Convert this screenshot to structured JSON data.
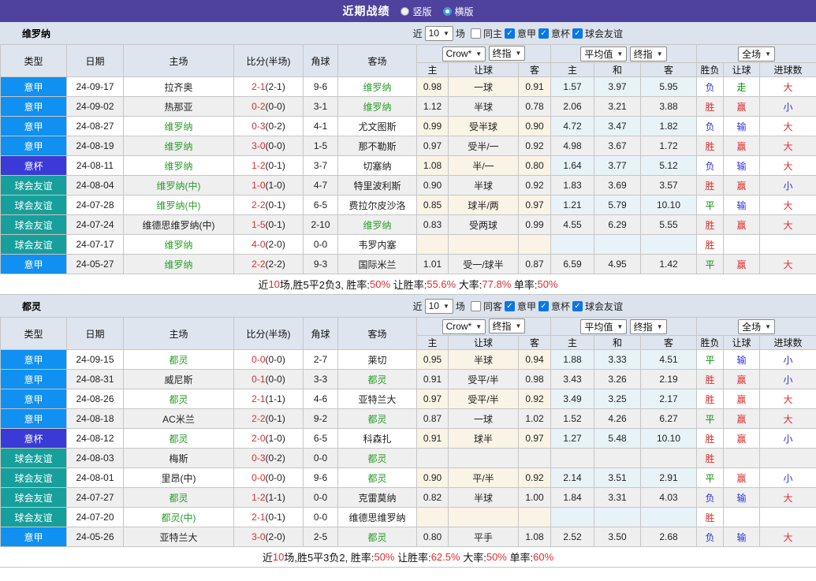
{
  "palette": {
    "topbar_bg": "#4f429e",
    "serie_a": "#1090f0",
    "coppa": "#3a3ad6",
    "friendly": "#17a09b",
    "red": "#e22c2c",
    "blue": "#3030dd",
    "green": "#0a8f0a",
    "team_green": "#2a9d2a",
    "half_score": "#222222",
    "radio_selected": "#3a9ae0",
    "checkbox_checked": "#0b76e8"
  },
  "top": {
    "title": "近期战绩",
    "modes": [
      {
        "label": "竖版",
        "selected": false
      },
      {
        "label": "横版",
        "selected": true
      }
    ]
  },
  "table_headers": {
    "main": [
      "类型",
      "日期",
      "主场",
      "比分(半场)",
      "角球",
      "客场"
    ],
    "odds_selects": [
      "Crow*",
      "终指"
    ],
    "avg_selects": [
      "平均值",
      "终指"
    ],
    "result_select": "全场",
    "odds_sub": [
      "主",
      "让球",
      "客"
    ],
    "avg_sub": [
      "主",
      "和",
      "客"
    ],
    "result_sub": [
      "胜负",
      "让球",
      "进球数"
    ]
  },
  "sections": [
    {
      "team": "维罗纳",
      "filter": {
        "near": "近",
        "count": "10",
        "games": "场",
        "same": {
          "label": "同主",
          "checked": false
        },
        "leagues": [
          {
            "label": "意甲",
            "checked": true
          },
          {
            "label": "意杯",
            "checked": true
          },
          {
            "label": "球会友谊",
            "checked": true
          }
        ]
      },
      "rows": [
        {
          "type": "意甲",
          "type_key": "serie_a",
          "date": "24-09-17",
          "home": "拉齐奥",
          "home_green": false,
          "score": "2-1",
          "half": "(2-1)",
          "corners": "9-6",
          "away": "维罗纳",
          "away_green": true,
          "odds": [
            "0.98",
            "一球",
            "0.91"
          ],
          "avg": [
            "1.57",
            "3.97",
            "5.95"
          ],
          "results": [
            [
              "负",
              "blue"
            ],
            [
              "走",
              "green"
            ],
            [
              "大",
              "red"
            ]
          ]
        },
        {
          "type": "意甲",
          "type_key": "serie_a",
          "date": "24-09-02",
          "home": "热那亚",
          "home_green": false,
          "score": "0-2",
          "half": "(0-0)",
          "corners": "3-1",
          "away": "维罗纳",
          "away_green": true,
          "odds": [
            "1.12",
            "半球",
            "0.78"
          ],
          "avg": [
            "2.06",
            "3.21",
            "3.88"
          ],
          "results": [
            [
              "胜",
              "red"
            ],
            [
              "赢",
              "red"
            ],
            [
              "小",
              "blue"
            ]
          ]
        },
        {
          "type": "意甲",
          "type_key": "serie_a",
          "date": "24-08-27",
          "home": "维罗纳",
          "home_green": true,
          "score": "0-3",
          "half": "(0-2)",
          "corners": "4-1",
          "away": "尤文图斯",
          "away_green": false,
          "odds": [
            "0.99",
            "受半球",
            "0.90"
          ],
          "avg": [
            "4.72",
            "3.47",
            "1.82"
          ],
          "results": [
            [
              "负",
              "blue"
            ],
            [
              "输",
              "blue"
            ],
            [
              "大",
              "red"
            ]
          ]
        },
        {
          "type": "意甲",
          "type_key": "serie_a",
          "date": "24-08-19",
          "home": "维罗纳",
          "home_green": true,
          "score": "3-0",
          "half": "(0-0)",
          "corners": "1-5",
          "away": "那不勒斯",
          "away_green": false,
          "odds": [
            "0.97",
            "受半/一",
            "0.92"
          ],
          "avg": [
            "4.98",
            "3.67",
            "1.72"
          ],
          "results": [
            [
              "胜",
              "red"
            ],
            [
              "赢",
              "red"
            ],
            [
              "大",
              "red"
            ]
          ]
        },
        {
          "type": "意杯",
          "type_key": "coppa",
          "date": "24-08-11",
          "home": "维罗纳",
          "home_green": true,
          "score": "1-2",
          "half": "(0-1)",
          "corners": "3-7",
          "away": "切塞纳",
          "away_green": false,
          "odds": [
            "1.08",
            "半/一",
            "0.80"
          ],
          "avg": [
            "1.64",
            "3.77",
            "5.12"
          ],
          "results": [
            [
              "负",
              "blue"
            ],
            [
              "输",
              "blue"
            ],
            [
              "大",
              "red"
            ]
          ]
        },
        {
          "type": "球会友谊",
          "type_key": "friendly",
          "date": "24-08-04",
          "home": "维罗纳(中)",
          "home_green": true,
          "score": "1-0",
          "half": "(1-0)",
          "corners": "4-7",
          "away": "特里波利斯",
          "away_green": false,
          "odds": [
            "0.90",
            "半球",
            "0.92"
          ],
          "avg": [
            "1.83",
            "3.69",
            "3.57"
          ],
          "results": [
            [
              "胜",
              "red"
            ],
            [
              "赢",
              "red"
            ],
            [
              "小",
              "blue"
            ]
          ]
        },
        {
          "type": "球会友谊",
          "type_key": "friendly",
          "date": "24-07-28",
          "home": "维罗纳(中)",
          "home_green": true,
          "score": "2-2",
          "half": "(0-1)",
          "corners": "6-5",
          "away": "费拉尔皮沙洛",
          "away_green": false,
          "odds": [
            "0.85",
            "球半/两",
            "0.97"
          ],
          "avg": [
            "1.21",
            "5.79",
            "10.10"
          ],
          "results": [
            [
              "平",
              "green"
            ],
            [
              "输",
              "blue"
            ],
            [
              "大",
              "red"
            ]
          ]
        },
        {
          "type": "球会友谊",
          "type_key": "friendly",
          "date": "24-07-24",
          "home": "维德思维罗纳(中)",
          "home_green": false,
          "score": "1-5",
          "half": "(0-1)",
          "corners": "2-10",
          "away": "维罗纳",
          "away_green": true,
          "odds": [
            "0.83",
            "受两球",
            "0.99"
          ],
          "avg": [
            "4.55",
            "6.29",
            "5.55"
          ],
          "results": [
            [
              "胜",
              "red"
            ],
            [
              "赢",
              "red"
            ],
            [
              "大",
              "red"
            ]
          ]
        },
        {
          "type": "球会友谊",
          "type_key": "friendly",
          "date": "24-07-17",
          "home": "维罗纳",
          "home_green": true,
          "score": "4-0",
          "half": "(2-0)",
          "corners": "0-0",
          "away": "韦罗内塞",
          "away_green": false,
          "odds": [
            "",
            "",
            ""
          ],
          "avg": [
            "",
            "",
            ""
          ],
          "results": [
            [
              "胜",
              "red"
            ],
            [
              "",
              ""
            ],
            [
              "",
              ""
            ]
          ]
        },
        {
          "type": "意甲",
          "type_key": "serie_a",
          "date": "24-05-27",
          "home": "维罗纳",
          "home_green": true,
          "score": "2-2",
          "half": "(2-2)",
          "corners": "9-3",
          "away": "国际米兰",
          "away_green": false,
          "odds": [
            "1.01",
            "受一/球半",
            "0.87"
          ],
          "avg": [
            "6.59",
            "4.95",
            "1.42"
          ],
          "results": [
            [
              "平",
              "green"
            ],
            [
              "赢",
              "red"
            ],
            [
              "大",
              "red"
            ]
          ]
        }
      ],
      "summary": [
        [
          "近",
          false
        ],
        [
          "10",
          true
        ],
        [
          "场,胜5平2负3, 胜率:",
          false
        ],
        [
          "50%",
          true
        ],
        [
          " 让胜率:",
          false
        ],
        [
          "55.6%",
          true
        ],
        [
          " 大率:",
          false
        ],
        [
          "77.8%",
          true
        ],
        [
          " 单率:",
          false
        ],
        [
          "50%",
          true
        ]
      ]
    },
    {
      "team": "都灵",
      "filter": {
        "near": "近",
        "count": "10",
        "games": "场",
        "same": {
          "label": "同客",
          "checked": false
        },
        "leagues": [
          {
            "label": "意甲",
            "checked": true
          },
          {
            "label": "意杯",
            "checked": true
          },
          {
            "label": "球会友谊",
            "checked": true
          }
        ]
      },
      "rows": [
        {
          "type": "意甲",
          "type_key": "serie_a",
          "date": "24-09-15",
          "home": "都灵",
          "home_green": true,
          "score": "0-0",
          "half": "(0-0)",
          "corners": "2-7",
          "away": "莱切",
          "away_green": false,
          "odds": [
            "0.95",
            "半球",
            "0.94"
          ],
          "avg": [
            "1.88",
            "3.33",
            "4.51"
          ],
          "results": [
            [
              "平",
              "green"
            ],
            [
              "输",
              "blue"
            ],
            [
              "小",
              "blue"
            ]
          ]
        },
        {
          "type": "意甲",
          "type_key": "serie_a",
          "date": "24-08-31",
          "home": "威尼斯",
          "home_green": false,
          "score": "0-1",
          "half": "(0-0)",
          "corners": "3-3",
          "away": "都灵",
          "away_green": true,
          "odds": [
            "0.91",
            "受平/半",
            "0.98"
          ],
          "avg": [
            "3.43",
            "3.26",
            "2.19"
          ],
          "results": [
            [
              "胜",
              "red"
            ],
            [
              "赢",
              "red"
            ],
            [
              "小",
              "blue"
            ]
          ]
        },
        {
          "type": "意甲",
          "type_key": "serie_a",
          "date": "24-08-26",
          "home": "都灵",
          "home_green": true,
          "score": "2-1",
          "half": "(1-1)",
          "corners": "4-6",
          "away": "亚特兰大",
          "away_green": false,
          "odds": [
            "0.97",
            "受平/半",
            "0.92"
          ],
          "avg": [
            "3.49",
            "3.25",
            "2.17"
          ],
          "results": [
            [
              "胜",
              "red"
            ],
            [
              "赢",
              "red"
            ],
            [
              "大",
              "red"
            ]
          ]
        },
        {
          "type": "意甲",
          "type_key": "serie_a",
          "date": "24-08-18",
          "home": "AC米兰",
          "home_green": false,
          "score": "2-2",
          "half": "(0-1)",
          "corners": "9-2",
          "away": "都灵",
          "away_green": true,
          "odds": [
            "0.87",
            "一球",
            "1.02"
          ],
          "avg": [
            "1.52",
            "4.26",
            "6.27"
          ],
          "results": [
            [
              "平",
              "green"
            ],
            [
              "赢",
              "red"
            ],
            [
              "大",
              "red"
            ]
          ]
        },
        {
          "type": "意杯",
          "type_key": "coppa",
          "date": "24-08-12",
          "home": "都灵",
          "home_green": true,
          "score": "2-0",
          "half": "(1-0)",
          "corners": "6-5",
          "away": "科森扎",
          "away_green": false,
          "odds": [
            "0.91",
            "球半",
            "0.97"
          ],
          "avg": [
            "1.27",
            "5.48",
            "10.10"
          ],
          "results": [
            [
              "胜",
              "red"
            ],
            [
              "赢",
              "red"
            ],
            [
              "小",
              "blue"
            ]
          ]
        },
        {
          "type": "球会友谊",
          "type_key": "friendly",
          "date": "24-08-03",
          "home": "梅斯",
          "home_green": false,
          "score": "0-3",
          "half": "(0-2)",
          "corners": "0-0",
          "away": "都灵",
          "away_green": true,
          "odds": [
            "",
            "",
            ""
          ],
          "avg": [
            "",
            "",
            ""
          ],
          "results": [
            [
              "胜",
              "red"
            ],
            [
              "",
              ""
            ],
            [
              "",
              ""
            ]
          ]
        },
        {
          "type": "球会友谊",
          "type_key": "friendly",
          "date": "24-08-01",
          "home": "里昂(中)",
          "home_green": false,
          "score": "0-0",
          "half": "(0-0)",
          "corners": "9-6",
          "away": "都灵",
          "away_green": true,
          "odds": [
            "0.90",
            "平/半",
            "0.92"
          ],
          "avg": [
            "2.14",
            "3.51",
            "2.91"
          ],
          "results": [
            [
              "平",
              "green"
            ],
            [
              "赢",
              "red"
            ],
            [
              "小",
              "blue"
            ]
          ]
        },
        {
          "type": "球会友谊",
          "type_key": "friendly",
          "date": "24-07-27",
          "home": "都灵",
          "home_green": true,
          "score": "1-2",
          "half": "(1-1)",
          "corners": "0-0",
          "away": "克雷莫纳",
          "away_green": false,
          "odds": [
            "0.82",
            "半球",
            "1.00"
          ],
          "avg": [
            "1.84",
            "3.31",
            "4.03"
          ],
          "results": [
            [
              "负",
              "blue"
            ],
            [
              "输",
              "blue"
            ],
            [
              "大",
              "red"
            ]
          ]
        },
        {
          "type": "球会友谊",
          "type_key": "friendly",
          "date": "24-07-20",
          "home": "都灵(中)",
          "home_green": true,
          "score": "2-1",
          "half": "(0-1)",
          "corners": "0-0",
          "away": "维德思维罗纳",
          "away_green": false,
          "odds": [
            "",
            "",
            ""
          ],
          "avg": [
            "",
            "",
            ""
          ],
          "results": [
            [
              "胜",
              "red"
            ],
            [
              "",
              ""
            ],
            [
              "",
              ""
            ]
          ]
        },
        {
          "type": "意甲",
          "type_key": "serie_a",
          "date": "24-05-26",
          "home": "亚特兰大",
          "home_green": false,
          "score": "3-0",
          "half": "(2-0)",
          "corners": "2-5",
          "away": "都灵",
          "away_green": true,
          "odds": [
            "0.80",
            "平手",
            "1.08"
          ],
          "avg": [
            "2.52",
            "3.50",
            "2.68"
          ],
          "results": [
            [
              "负",
              "blue"
            ],
            [
              "输",
              "blue"
            ],
            [
              "大",
              "red"
            ]
          ]
        }
      ],
      "summary": [
        [
          "近",
          false
        ],
        [
          "10",
          true
        ],
        [
          "场,胜5平3负2, 胜率:",
          false
        ],
        [
          "50%",
          true
        ],
        [
          " 让胜率:",
          false
        ],
        [
          "62.5%",
          true
        ],
        [
          " 大率:",
          false
        ],
        [
          "50%",
          true
        ],
        [
          " 单率:",
          false
        ],
        [
          "60%",
          true
        ]
      ]
    }
  ]
}
